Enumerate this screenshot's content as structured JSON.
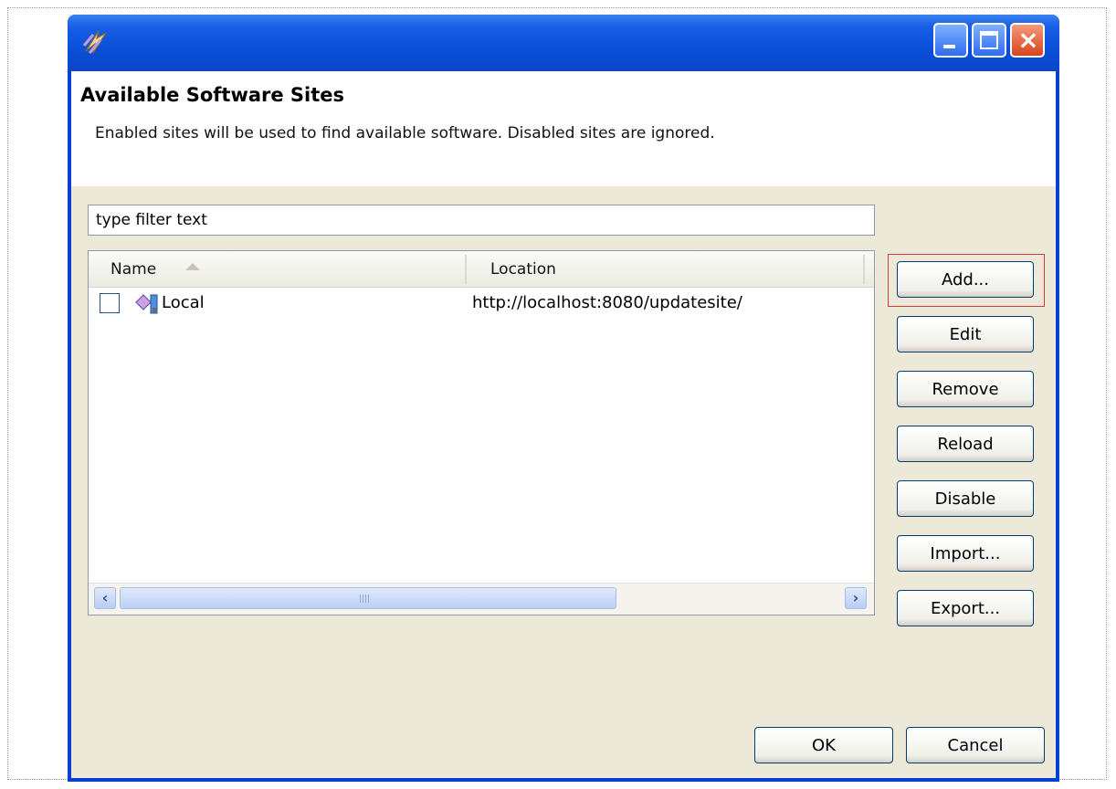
{
  "dialog": {
    "title": "Available Software Sites",
    "description": "Enabled sites will be used to find available software.  Disabled sites are ignored."
  },
  "titlebar": {
    "icon": "eclipse-plugin-icon",
    "buttons": [
      "minimize-icon",
      "maximize-icon",
      "close-icon"
    ]
  },
  "filter": {
    "value": "type filter text"
  },
  "table": {
    "columns": [
      "Name",
      "Location"
    ],
    "sort_column": "Name",
    "rows": [
      {
        "enabled": false,
        "icon": "update-site-icon",
        "name": "Local",
        "location": "http://localhost:8080/updatesite/"
      }
    ]
  },
  "side_buttons": {
    "add": "Add...",
    "edit": "Edit",
    "remove": "Remove",
    "reload": "Reload",
    "disable": "Disable",
    "import": "Import...",
    "export": "Export..."
  },
  "footer": {
    "ok": "OK",
    "cancel": "Cancel"
  },
  "colors": {
    "titlebar": "#0a4fd8",
    "dialog_body": "#ece9d8",
    "highlight": "#d33a3a"
  }
}
